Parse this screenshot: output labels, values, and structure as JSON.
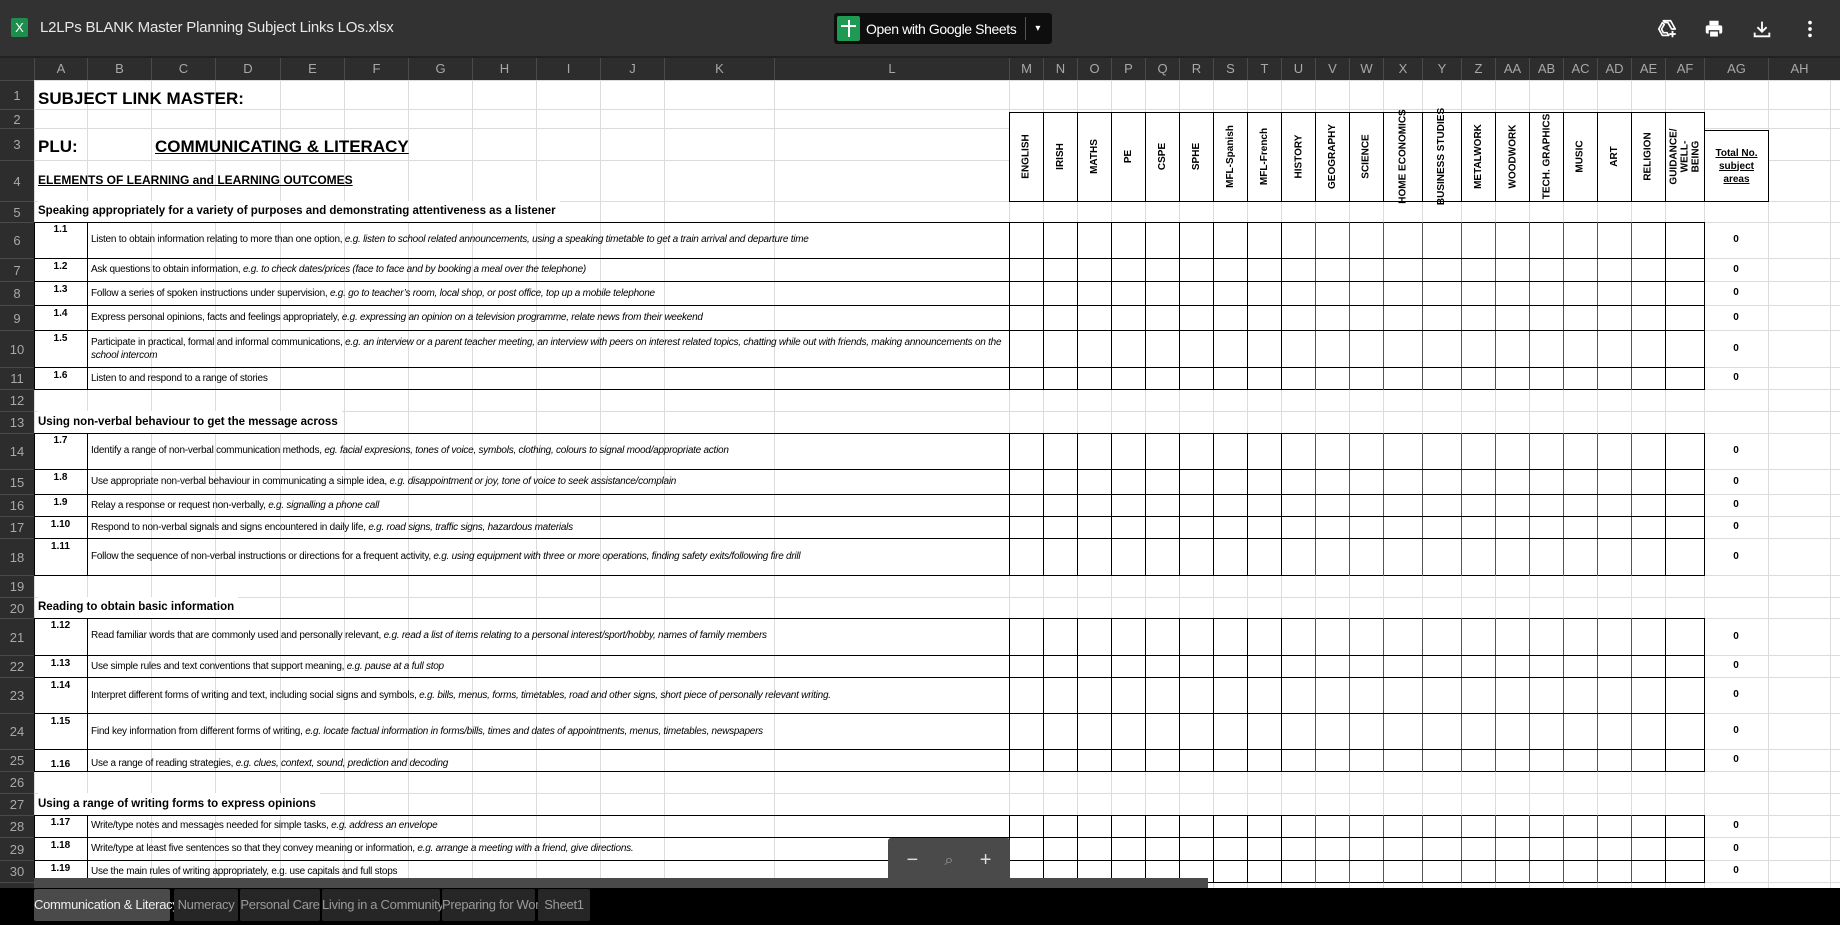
{
  "topbar": {
    "file_icon_letter": "X",
    "file_title": "L2LPs BLANK Master Planning Subject Links LOs.xlsx",
    "open_with_label": "Open with Google Sheets",
    "open_caret": "▾",
    "icons": [
      "add-to-drive-icon",
      "print-icon",
      "download-icon",
      "more-options-icon"
    ]
  },
  "columns": [
    "A",
    "B",
    "C",
    "D",
    "E",
    "F",
    "G",
    "H",
    "I",
    "J",
    "K",
    "L",
    "M",
    "N",
    "O",
    "P",
    "Q",
    "R",
    "S",
    "T",
    "U",
    "V",
    "W",
    "X",
    "Y",
    "Z",
    "AA",
    "AB",
    "AC",
    "AD",
    "AE",
    "AF",
    "AG",
    "AH"
  ],
  "rows": [
    "1",
    "2",
    "3",
    "4",
    "5",
    "6",
    "7",
    "8",
    "9",
    "10",
    "11",
    "12",
    "13",
    "14",
    "15",
    "16",
    "17",
    "18",
    "19",
    "20",
    "21",
    "22",
    "23",
    "24",
    "25",
    "26",
    "27",
    "28",
    "29",
    "30"
  ],
  "sheet": {
    "title": "SUBJECT LINK MASTER:",
    "plu_label": "PLU:",
    "plu_value": "COMMUNICATING & LITERACY",
    "elements_heading": "ELEMENTS OF LEARNING and LEARNING OUTCOMES",
    "subjects": [
      "ENGLISH",
      "IRISH",
      "MATHS",
      "PE",
      "CSPE",
      "SPHE",
      "MFL-Spanish",
      "MFL-French",
      "HISTORY",
      "GEOGRAPHY",
      "SCIENCE",
      "HOME ECONOMICS",
      "BUSINESS STUDIES",
      "METALWORK",
      "WOODWORK",
      "TECH. GRAPHICS",
      "MUSIC",
      "ART",
      "RELIGION",
      "GUIDANCE/ WELL-BEING"
    ],
    "total_label": "Total No. subject areas",
    "sections": [
      {
        "heading": "Speaking appropriately for a variety of purposes and demonstrating attentiveness as a listener",
        "outcomes": [
          {
            "code": "1.1",
            "text": "Listen to obtain information relating to more than one option, ",
            "example": "e.g. listen to school related announcements, using a speaking timetable to get a train arrival and departure time",
            "total": "0"
          },
          {
            "code": "1.2",
            "text": "Ask questions to obtain information, ",
            "example": "e.g. to check dates/prices (face to face and by  booking a meal over the telephone)",
            "total": "0"
          },
          {
            "code": "1.3",
            "text": "Follow a series of spoken instructions under supervision, ",
            "example": "e.g. go to teacher’s room, local shop, or post office, top up a mobile telephone",
            "total": "0"
          },
          {
            "code": "1.4",
            "text": "Express personal opinions, facts and feelings appropriately, ",
            "example": "e.g. expressing an opinion on a television programme, relate news from their weekend",
            "total": "0"
          },
          {
            "code": "1.5",
            "text": "Participate in practical, formal and informal communications, ",
            "example": "e.g. an interview or a parent teacher meeting, an interview with peers on interest related topics, chatting while out with friends, making announcements on the school intercom",
            "total": "0"
          },
          {
            "code": "1.6",
            "text": "Listen to and respond to a range of stories",
            "example": "",
            "total": "0"
          }
        ]
      },
      {
        "heading": "Using non-verbal behaviour to get the message across",
        "outcomes": [
          {
            "code": "1.7",
            "text": "Identify a range of non-verbal communication methods, ",
            "example": "eg. facial expresions, tones of voice, symbols, clothing, colours to signal mood/appropriate action",
            "total": "0"
          },
          {
            "code": "1.8",
            "text": "Use appropriate non-verbal behaviour in communicating a simple idea, ",
            "example": "e.g. disappointment or joy, tone of voice to seek assistance/complain",
            "total": "0"
          },
          {
            "code": "1.9",
            "text": "Relay a response or request non-verbally, ",
            "example": "e.g. signalling a phone call",
            "total": "0"
          },
          {
            "code": "1.10",
            "text": "Respond to non-verbal signals and signs encountered in daily life, ",
            "example": "e.g. road signs, traffic signs, hazardous materials",
            "total": "0"
          },
          {
            "code": "1.11",
            "text": "Follow the sequence of non-verbal instructions or directions for a frequent activity, ",
            "example": "e.g. using equipment with three or more operations, finding safety exits/following fire drill",
            "total": "0"
          }
        ]
      },
      {
        "heading": "Reading to obtain basic information",
        "outcomes": [
          {
            "code": "1.12",
            "text": "Read familiar words that are commonly used and personally relevant, ",
            "example": "e.g. read a list of items relating to a personal interest/sport/hobby, names of family members",
            "total": "0"
          },
          {
            "code": "1.13",
            "text": "Use simple rules and text conventions that support meaning, ",
            "example": "e.g. pause at a full stop",
            "total": "0"
          },
          {
            "code": "1.14",
            "text": "Interpret different forms of writing and text, including social signs and symbols, ",
            "example": "e.g.  bills, menus, forms, timetables, road and other signs, short piece of personally relevant writing.",
            "total": "0"
          },
          {
            "code": "1.15",
            "text": "Find key information from different forms of writing, ",
            "example": "e.g. locate factual information in forms/bills, times and dates of appointments, menus, timetables, newspapers",
            "total": "0"
          },
          {
            "code": "1.16",
            "text": "Use a range of reading strategies, ",
            "example": "e.g. clues, context, sound, prediction and decoding",
            "total": "0"
          }
        ]
      },
      {
        "heading": "Using a range of writing forms to express opinions",
        "outcomes": [
          {
            "code": "1.17",
            "text": "Write/type notes and messages needed for simple tasks, ",
            "example": "e.g. address an envelope",
            "total": "0"
          },
          {
            "code": "1.18",
            "text": "Write/type at least five sentences so that they convey meaning or information, ",
            "example": "e.g. arrange a meeting with a friend, give directions.",
            "total": "0"
          },
          {
            "code": "1.19",
            "text": "Use the main rules of writing appropriately, e.g. use capitals and full stops",
            "example": "",
            "total": "0"
          }
        ]
      }
    ]
  },
  "zoom_controls": {
    "zoom_out": "−",
    "zoom_reset": "⌕",
    "zoom_in": "+"
  },
  "tabs": [
    {
      "label": "Communication & Literacy",
      "active": true
    },
    {
      "label": "Numeracy",
      "active": false
    },
    {
      "label": "Personal Care",
      "active": false
    },
    {
      "label": "Living in a Community",
      "active": false
    },
    {
      "label": "Preparing for Work",
      "active": false
    },
    {
      "label": "Sheet1",
      "active": false
    }
  ]
}
